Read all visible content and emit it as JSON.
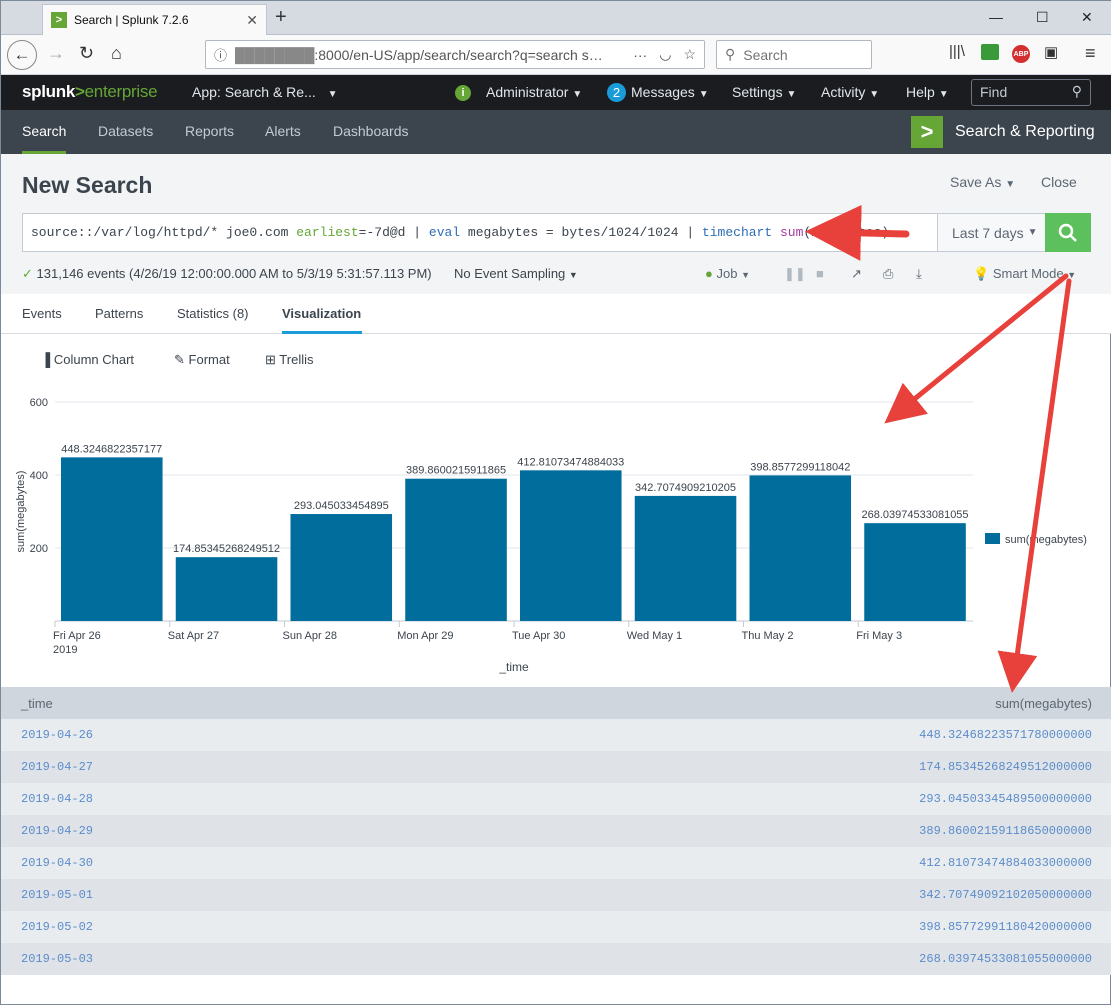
{
  "browser": {
    "tab_title": "Search | Splunk 7.2.6",
    "tab_favicon": ">",
    "url_host": "████████",
    "url_rest": ":8000/en-US/app/search/search?q=search s…",
    "search_placeholder": "Search"
  },
  "splunk_bar": {
    "logo_a": "splunk",
    "logo_gt": ">",
    "logo_b": "enterprise",
    "app_menu": "App: Search & Re...",
    "admin": "Administrator",
    "messages_count": "2",
    "messages": "Messages",
    "settings": "Settings",
    "activity": "Activity",
    "help": "Help",
    "find_placeholder": "Find"
  },
  "app_bar": {
    "tabs": [
      "Search",
      "Datasets",
      "Reports",
      "Alerts",
      "Dashboards"
    ],
    "app_name": "Search & Reporting"
  },
  "page": {
    "title": "New Search",
    "save_as": "Save As",
    "close": "Close"
  },
  "search": {
    "q1": "source::/var/log/httpd/* joe0.com ",
    "q2": "earliest",
    "q3": "=-7d@d | ",
    "q4": "eval",
    "q5": " megabytes = bytes/1024/1024 | ",
    "q6": "timechart",
    "q7": " ",
    "q8": "sum",
    "q9": "(megabytes)",
    "time_range": "Last 7 days"
  },
  "status": {
    "events": "131,146 events (4/26/19 12:00:00.000 AM to 5/3/19 5:31:57.113 PM)",
    "sampling": "No Event Sampling",
    "job": "Job",
    "mode": "Smart Mode"
  },
  "result_tabs": [
    "Events",
    "Patterns",
    "Statistics (8)",
    "Visualization"
  ],
  "viz_toolbar": {
    "chart_type": "Column Chart",
    "format": "Format",
    "trellis": "Trellis"
  },
  "chart_data": {
    "type": "bar",
    "categories": [
      "Fri Apr 26",
      "Sat Apr 27",
      "Sun Apr 28",
      "Mon Apr 29",
      "Tue Apr 30",
      "Wed May 1",
      "Thu May 2",
      "Fri May 3"
    ],
    "first_category_year": "2019",
    "series": [
      {
        "name": "sum(megabytes)",
        "values": [
          448.3246822357177,
          174.85345268249512,
          293.045033454895,
          389.8600215911865,
          412.81073474884033,
          342.7074909210205,
          398.8577299118042,
          268.03974533081055
        ]
      }
    ],
    "labels": [
      "448.3246822357177",
      "174.85345268249512",
      "293.045033454895",
      "389.8600215911865",
      "412.81073474884033",
      "342.7074909210205",
      "398.8577299118042",
      "268.03974533081055"
    ],
    "xlabel": "_time",
    "ylabel": "sum(megabytes)",
    "ylim": [
      0,
      600
    ],
    "yticks": [
      200,
      400,
      600
    ],
    "color": "#006d9c",
    "legend": "right"
  },
  "table": {
    "columns": [
      "_time",
      "sum(megabytes)"
    ],
    "rows": [
      [
        "2019-04-26",
        "448.32468223571780000000"
      ],
      [
        "2019-04-27",
        "174.85345268249512000000"
      ],
      [
        "2019-04-28",
        "293.04503345489500000000"
      ],
      [
        "2019-04-29",
        "389.86002159118650000000"
      ],
      [
        "2019-04-30",
        "412.81073474884033000000"
      ],
      [
        "2019-05-01",
        "342.70749092102050000000"
      ],
      [
        "2019-05-02",
        "398.85772991180420000000"
      ],
      [
        "2019-05-03",
        "268.03974533081055000000"
      ]
    ]
  },
  "colors": {
    "accent": "#65a637",
    "annotation_arrow": "#e8403a"
  }
}
